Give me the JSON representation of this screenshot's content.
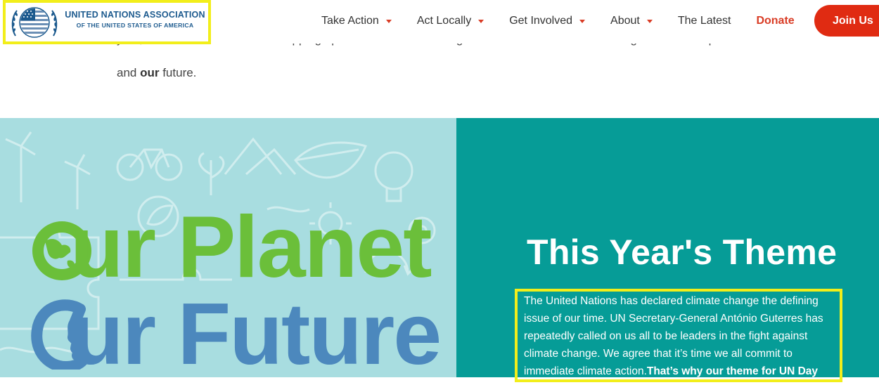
{
  "header": {
    "logo": {
      "line1": "UNITED NATIONS ASSOCIATION",
      "line2": "OF THE UNITED STATES OF AMERICA"
    },
    "nav": [
      {
        "label": "Take Action",
        "has_dropdown": true
      },
      {
        "label": "Act Locally",
        "has_dropdown": true
      },
      {
        "label": "Get Involved",
        "has_dropdown": true
      },
      {
        "label": "About",
        "has_dropdown": true
      }
    ],
    "latest_label": "The Latest",
    "donate_label": "Donate",
    "join_label": "Join Us"
  },
  "intro": {
    "line1": "year, UNA-USA is focused on stepping up to confront the defining issue of our time: Climate change. This is our planet",
    "line2_pre": "and ",
    "line2_bold": "our",
    "line2_post": " future."
  },
  "art": {
    "word_planet": "ur Planet",
    "word_future": "ur Future"
  },
  "theme": {
    "title": "This Year's Theme",
    "body": "The United Nations has declared climate change the defining issue of our time. UN Secretary-General António Guterres has repeatedly called on us all to be leaders in the fight against climate change. We agree that it’s time we all commit to immediate climate action.",
    "body_bold": "That’s why our theme for UN Day"
  },
  "colors": {
    "accent_red": "#d93c25",
    "teal": "#069c97",
    "art_bg": "#a8dde0",
    "planet_green": "#6bbf3a",
    "future_blue": "#4c88bd",
    "highlight_yellow": "#f2ee1a"
  }
}
